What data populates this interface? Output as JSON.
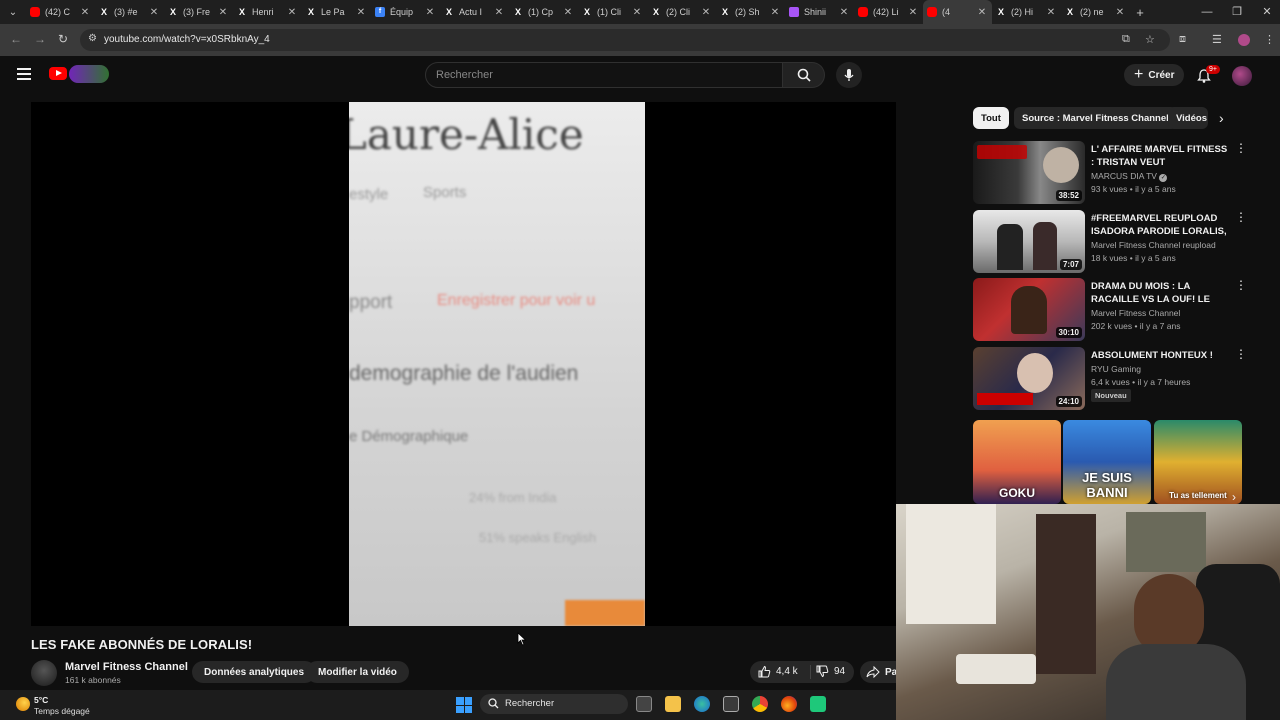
{
  "browser": {
    "tabs": [
      {
        "title": "(42) C",
        "icon": "youtube-icon"
      },
      {
        "title": "(3) #e",
        "icon": "x-icon"
      },
      {
        "title": "(3) Fre",
        "icon": "x-icon"
      },
      {
        "title": "Henri",
        "icon": "x-icon"
      },
      {
        "title": "Le Pa",
        "icon": "x-icon"
      },
      {
        "title": "Équip",
        "icon": "blue-f-icon"
      },
      {
        "title": "Actu I",
        "icon": "x-icon"
      },
      {
        "title": "(1) Cp",
        "icon": "x-icon"
      },
      {
        "title": "(1) Cli",
        "icon": "x-icon"
      },
      {
        "title": "(2) Cli",
        "icon": "x-icon"
      },
      {
        "title": "(2) Sh",
        "icon": "x-icon"
      },
      {
        "title": "Shinii",
        "icon": "purple-icon"
      },
      {
        "title": "(42) Li",
        "icon": "youtube-icon"
      },
      {
        "title": "(4",
        "icon": "youtube-icon",
        "active": true
      },
      {
        "title": "(2) Hi",
        "icon": "x-icon"
      },
      {
        "title": "(2) ne",
        "icon": "x-icon"
      }
    ],
    "url": "youtube.com/watch?v=x0SRbknAy_4"
  },
  "youtube": {
    "search_placeholder": "Rechercher",
    "create_label": "Créer",
    "notif_count": "9+"
  },
  "video": {
    "title": "LES FAKE ABONNÉS DE LORALIS!",
    "channel": "Marvel Fitness Channel",
    "subscribers": "161 k abonnés",
    "analytics_label": "Données analytiques",
    "edit_label": "Modifier la vidéo",
    "likes": "4,4 k",
    "dislikes": "94",
    "share_label": "Pa",
    "frame_text": {
      "heading": "Laure-Alice",
      "nav1": "estyle",
      "nav2": "Sports",
      "line1": "pport",
      "line1_red": "Enregistrer pour voir u",
      "line2": "demographie de l'audien",
      "line3": "e Démographique",
      "stat1": "24% from India",
      "stat2": "51% speaks English"
    }
  },
  "sidebar": {
    "chips": [
      "Tout",
      "Source : Marvel Fitness Channel",
      "Vidéos"
    ],
    "recommendations": [
      {
        "title": "L' AFFAIRE MARVEL FITNESS : TRISTAN VEUT S'EXPLIQUER !!!",
        "channel": "MARCUS DIA TV",
        "meta": "93 k vues • il y a 5 ans",
        "duration": "38:52",
        "verified": true
      },
      {
        "title": "#FREEMARVEL REUPLOAD ISADORA PARODIE   LORALIS, ...",
        "channel": "Marvel Fitness Channel reupload",
        "meta": "18 k vues • il y a 5 ans",
        "duration": "7:07"
      },
      {
        "title": "DRAMA DU MOIS : LA RACAILLE VS LA OUF! LE CAS ...",
        "channel": "Marvel Fitness Channel",
        "meta": "202 k vues • il y a 7 ans",
        "duration": "30:10"
      },
      {
        "title": "ABSOLUMENT HONTEUX !",
        "channel": "RYU Gaming",
        "meta": "6,4 k vues • il y a 7 heures",
        "duration": "24:10",
        "badge": "Nouveau"
      }
    ],
    "shorts": [
      {
        "caption": "GOKU"
      },
      {
        "caption": "JE SUIS BANNI"
      },
      {
        "caption": "Tu as tellement"
      }
    ]
  },
  "taskbar": {
    "temp": "5°C",
    "weather": "Temps dégagé",
    "search_placeholder": "Rechercher"
  },
  "colors": {
    "accent": "#ff0000",
    "bg": "#0f0f0f",
    "chip": "#272727"
  }
}
